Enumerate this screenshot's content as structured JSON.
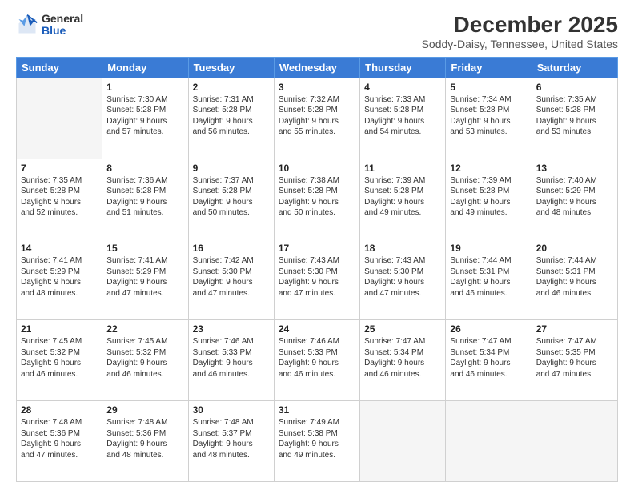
{
  "logo": {
    "line1": "General",
    "line2": "Blue"
  },
  "title": "December 2025",
  "subtitle": "Soddy-Daisy, Tennessee, United States",
  "headers": [
    "Sunday",
    "Monday",
    "Tuesday",
    "Wednesday",
    "Thursday",
    "Friday",
    "Saturday"
  ],
  "weeks": [
    [
      {
        "day": "",
        "info": ""
      },
      {
        "day": "1",
        "info": "Sunrise: 7:30 AM\nSunset: 5:28 PM\nDaylight: 9 hours\nand 57 minutes."
      },
      {
        "day": "2",
        "info": "Sunrise: 7:31 AM\nSunset: 5:28 PM\nDaylight: 9 hours\nand 56 minutes."
      },
      {
        "day": "3",
        "info": "Sunrise: 7:32 AM\nSunset: 5:28 PM\nDaylight: 9 hours\nand 55 minutes."
      },
      {
        "day": "4",
        "info": "Sunrise: 7:33 AM\nSunset: 5:28 PM\nDaylight: 9 hours\nand 54 minutes."
      },
      {
        "day": "5",
        "info": "Sunrise: 7:34 AM\nSunset: 5:28 PM\nDaylight: 9 hours\nand 53 minutes."
      },
      {
        "day": "6",
        "info": "Sunrise: 7:35 AM\nSunset: 5:28 PM\nDaylight: 9 hours\nand 53 minutes."
      }
    ],
    [
      {
        "day": "7",
        "info": "Sunrise: 7:35 AM\nSunset: 5:28 PM\nDaylight: 9 hours\nand 52 minutes."
      },
      {
        "day": "8",
        "info": "Sunrise: 7:36 AM\nSunset: 5:28 PM\nDaylight: 9 hours\nand 51 minutes."
      },
      {
        "day": "9",
        "info": "Sunrise: 7:37 AM\nSunset: 5:28 PM\nDaylight: 9 hours\nand 50 minutes."
      },
      {
        "day": "10",
        "info": "Sunrise: 7:38 AM\nSunset: 5:28 PM\nDaylight: 9 hours\nand 50 minutes."
      },
      {
        "day": "11",
        "info": "Sunrise: 7:39 AM\nSunset: 5:28 PM\nDaylight: 9 hours\nand 49 minutes."
      },
      {
        "day": "12",
        "info": "Sunrise: 7:39 AM\nSunset: 5:28 PM\nDaylight: 9 hours\nand 49 minutes."
      },
      {
        "day": "13",
        "info": "Sunrise: 7:40 AM\nSunset: 5:29 PM\nDaylight: 9 hours\nand 48 minutes."
      }
    ],
    [
      {
        "day": "14",
        "info": "Sunrise: 7:41 AM\nSunset: 5:29 PM\nDaylight: 9 hours\nand 48 minutes."
      },
      {
        "day": "15",
        "info": "Sunrise: 7:41 AM\nSunset: 5:29 PM\nDaylight: 9 hours\nand 47 minutes."
      },
      {
        "day": "16",
        "info": "Sunrise: 7:42 AM\nSunset: 5:30 PM\nDaylight: 9 hours\nand 47 minutes."
      },
      {
        "day": "17",
        "info": "Sunrise: 7:43 AM\nSunset: 5:30 PM\nDaylight: 9 hours\nand 47 minutes."
      },
      {
        "day": "18",
        "info": "Sunrise: 7:43 AM\nSunset: 5:30 PM\nDaylight: 9 hours\nand 47 minutes."
      },
      {
        "day": "19",
        "info": "Sunrise: 7:44 AM\nSunset: 5:31 PM\nDaylight: 9 hours\nand 46 minutes."
      },
      {
        "day": "20",
        "info": "Sunrise: 7:44 AM\nSunset: 5:31 PM\nDaylight: 9 hours\nand 46 minutes."
      }
    ],
    [
      {
        "day": "21",
        "info": "Sunrise: 7:45 AM\nSunset: 5:32 PM\nDaylight: 9 hours\nand 46 minutes."
      },
      {
        "day": "22",
        "info": "Sunrise: 7:45 AM\nSunset: 5:32 PM\nDaylight: 9 hours\nand 46 minutes."
      },
      {
        "day": "23",
        "info": "Sunrise: 7:46 AM\nSunset: 5:33 PM\nDaylight: 9 hours\nand 46 minutes."
      },
      {
        "day": "24",
        "info": "Sunrise: 7:46 AM\nSunset: 5:33 PM\nDaylight: 9 hours\nand 46 minutes."
      },
      {
        "day": "25",
        "info": "Sunrise: 7:47 AM\nSunset: 5:34 PM\nDaylight: 9 hours\nand 46 minutes."
      },
      {
        "day": "26",
        "info": "Sunrise: 7:47 AM\nSunset: 5:34 PM\nDaylight: 9 hours\nand 46 minutes."
      },
      {
        "day": "27",
        "info": "Sunrise: 7:47 AM\nSunset: 5:35 PM\nDaylight: 9 hours\nand 47 minutes."
      }
    ],
    [
      {
        "day": "28",
        "info": "Sunrise: 7:48 AM\nSunset: 5:36 PM\nDaylight: 9 hours\nand 47 minutes."
      },
      {
        "day": "29",
        "info": "Sunrise: 7:48 AM\nSunset: 5:36 PM\nDaylight: 9 hours\nand 48 minutes."
      },
      {
        "day": "30",
        "info": "Sunrise: 7:48 AM\nSunset: 5:37 PM\nDaylight: 9 hours\nand 48 minutes."
      },
      {
        "day": "31",
        "info": "Sunrise: 7:49 AM\nSunset: 5:38 PM\nDaylight: 9 hours\nand 49 minutes."
      },
      {
        "day": "",
        "info": ""
      },
      {
        "day": "",
        "info": ""
      },
      {
        "day": "",
        "info": ""
      }
    ]
  ]
}
